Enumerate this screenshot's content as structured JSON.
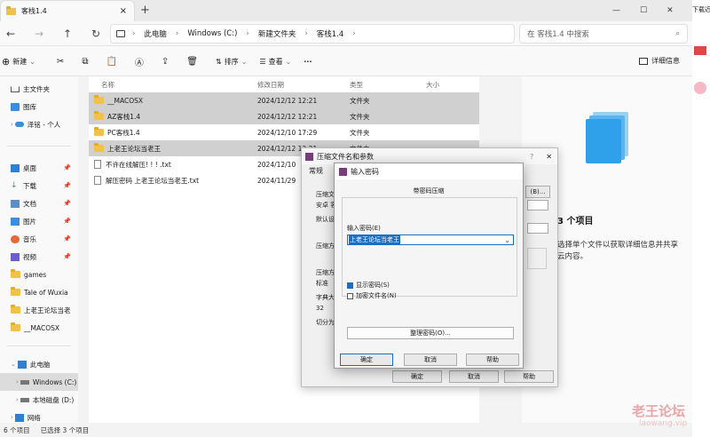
{
  "tab": {
    "title": "客栈1.4",
    "close": "×",
    "new": "+"
  },
  "window": {
    "min": "—",
    "max": "☐",
    "close": "✕"
  },
  "nav": {
    "crumbs": [
      "此电脑",
      "Windows (C:)",
      "新建文件夹",
      "客栈1.4"
    ],
    "search_placeholder": "在 客栈1.4 中搜索"
  },
  "toolbar": {
    "new": "新建",
    "sort": "排序",
    "view": "查看",
    "more": "···",
    "details": "详细信息"
  },
  "sidebar": {
    "top": [
      {
        "label": "主文件夹"
      },
      {
        "label": "图库"
      },
      {
        "label": "泽铭 - 个人"
      }
    ],
    "pinned": [
      {
        "label": "桌面"
      },
      {
        "label": "下载"
      },
      {
        "label": "文档"
      },
      {
        "label": "图片"
      },
      {
        "label": "音乐"
      },
      {
        "label": "视频"
      },
      {
        "label": "games"
      },
      {
        "label": "Tale of Wuxia"
      },
      {
        "label": "上老王论坛当老"
      },
      {
        "label": "__MACOSX"
      }
    ],
    "bottom": [
      {
        "label": "此电脑"
      },
      {
        "label": "Windows (C:)"
      },
      {
        "label": "本地磁盘 (D:)"
      },
      {
        "label": "网络"
      }
    ]
  },
  "files": {
    "headers": [
      "名称",
      "修改日期",
      "类型",
      "大小"
    ],
    "rows": [
      {
        "name": "__MACOSX",
        "date": "2024/12/12 12:21",
        "type": "文件夹",
        "kind": "folder",
        "selected": true
      },
      {
        "name": "AZ客栈1.4",
        "date": "2024/12/12 12:21",
        "type": "文件夹",
        "kind": "folder",
        "selected": true
      },
      {
        "name": "PC客栈1.4",
        "date": "2024/12/10 17:29",
        "type": "文件夹",
        "kind": "folder",
        "selected": false
      },
      {
        "name": "上老王论坛当老王",
        "date": "2024/12/12 12:21",
        "type": "文件夹",
        "kind": "folder",
        "selected": true
      },
      {
        "name": "不许在线解压! ! ! .txt",
        "date": "2024/12/10",
        "type": "",
        "kind": "doc",
        "selected": false
      },
      {
        "name": "解压密码 上老王论坛当老王.txt",
        "date": "2024/11/29",
        "type": "",
        "kind": "doc",
        "selected": false
      }
    ]
  },
  "detail": {
    "title": "3 个项目",
    "desc": "选择单个文件以获取详细信息并共享云内容。"
  },
  "status": {
    "count": "6 个项目",
    "selected": "已选择 3 个项目"
  },
  "right_strip": {
    "text": "下载近"
  },
  "archive_dialog": {
    "title": "压缩文件名和参数",
    "help_q": "?",
    "close": "✕",
    "tabs": [
      "常规",
      "高"
    ],
    "labels": [
      "压缩文",
      "安卓 客",
      "默认设",
      "压缩方",
      "压缩方",
      "标准",
      "字典大",
      "32",
      "切分为"
    ],
    "browse": "(B)...",
    "ok": "确定",
    "cancel": "取消",
    "help": "帮助"
  },
  "pwd_dialog": {
    "title": "输入密码",
    "heading": "带密码压缩",
    "pwd_label": "输入密码(E)",
    "pwd_value": "上老王论坛当老王",
    "show_pwd": "显示密码(S)",
    "encrypt_names": "加密文件名(N)",
    "organize": "整理密码(O)...",
    "ok": "确定",
    "cancel": "取消",
    "help": "帮助"
  },
  "watermark": {
    "main": "老王论坛",
    "sub": "laowang.vip"
  }
}
